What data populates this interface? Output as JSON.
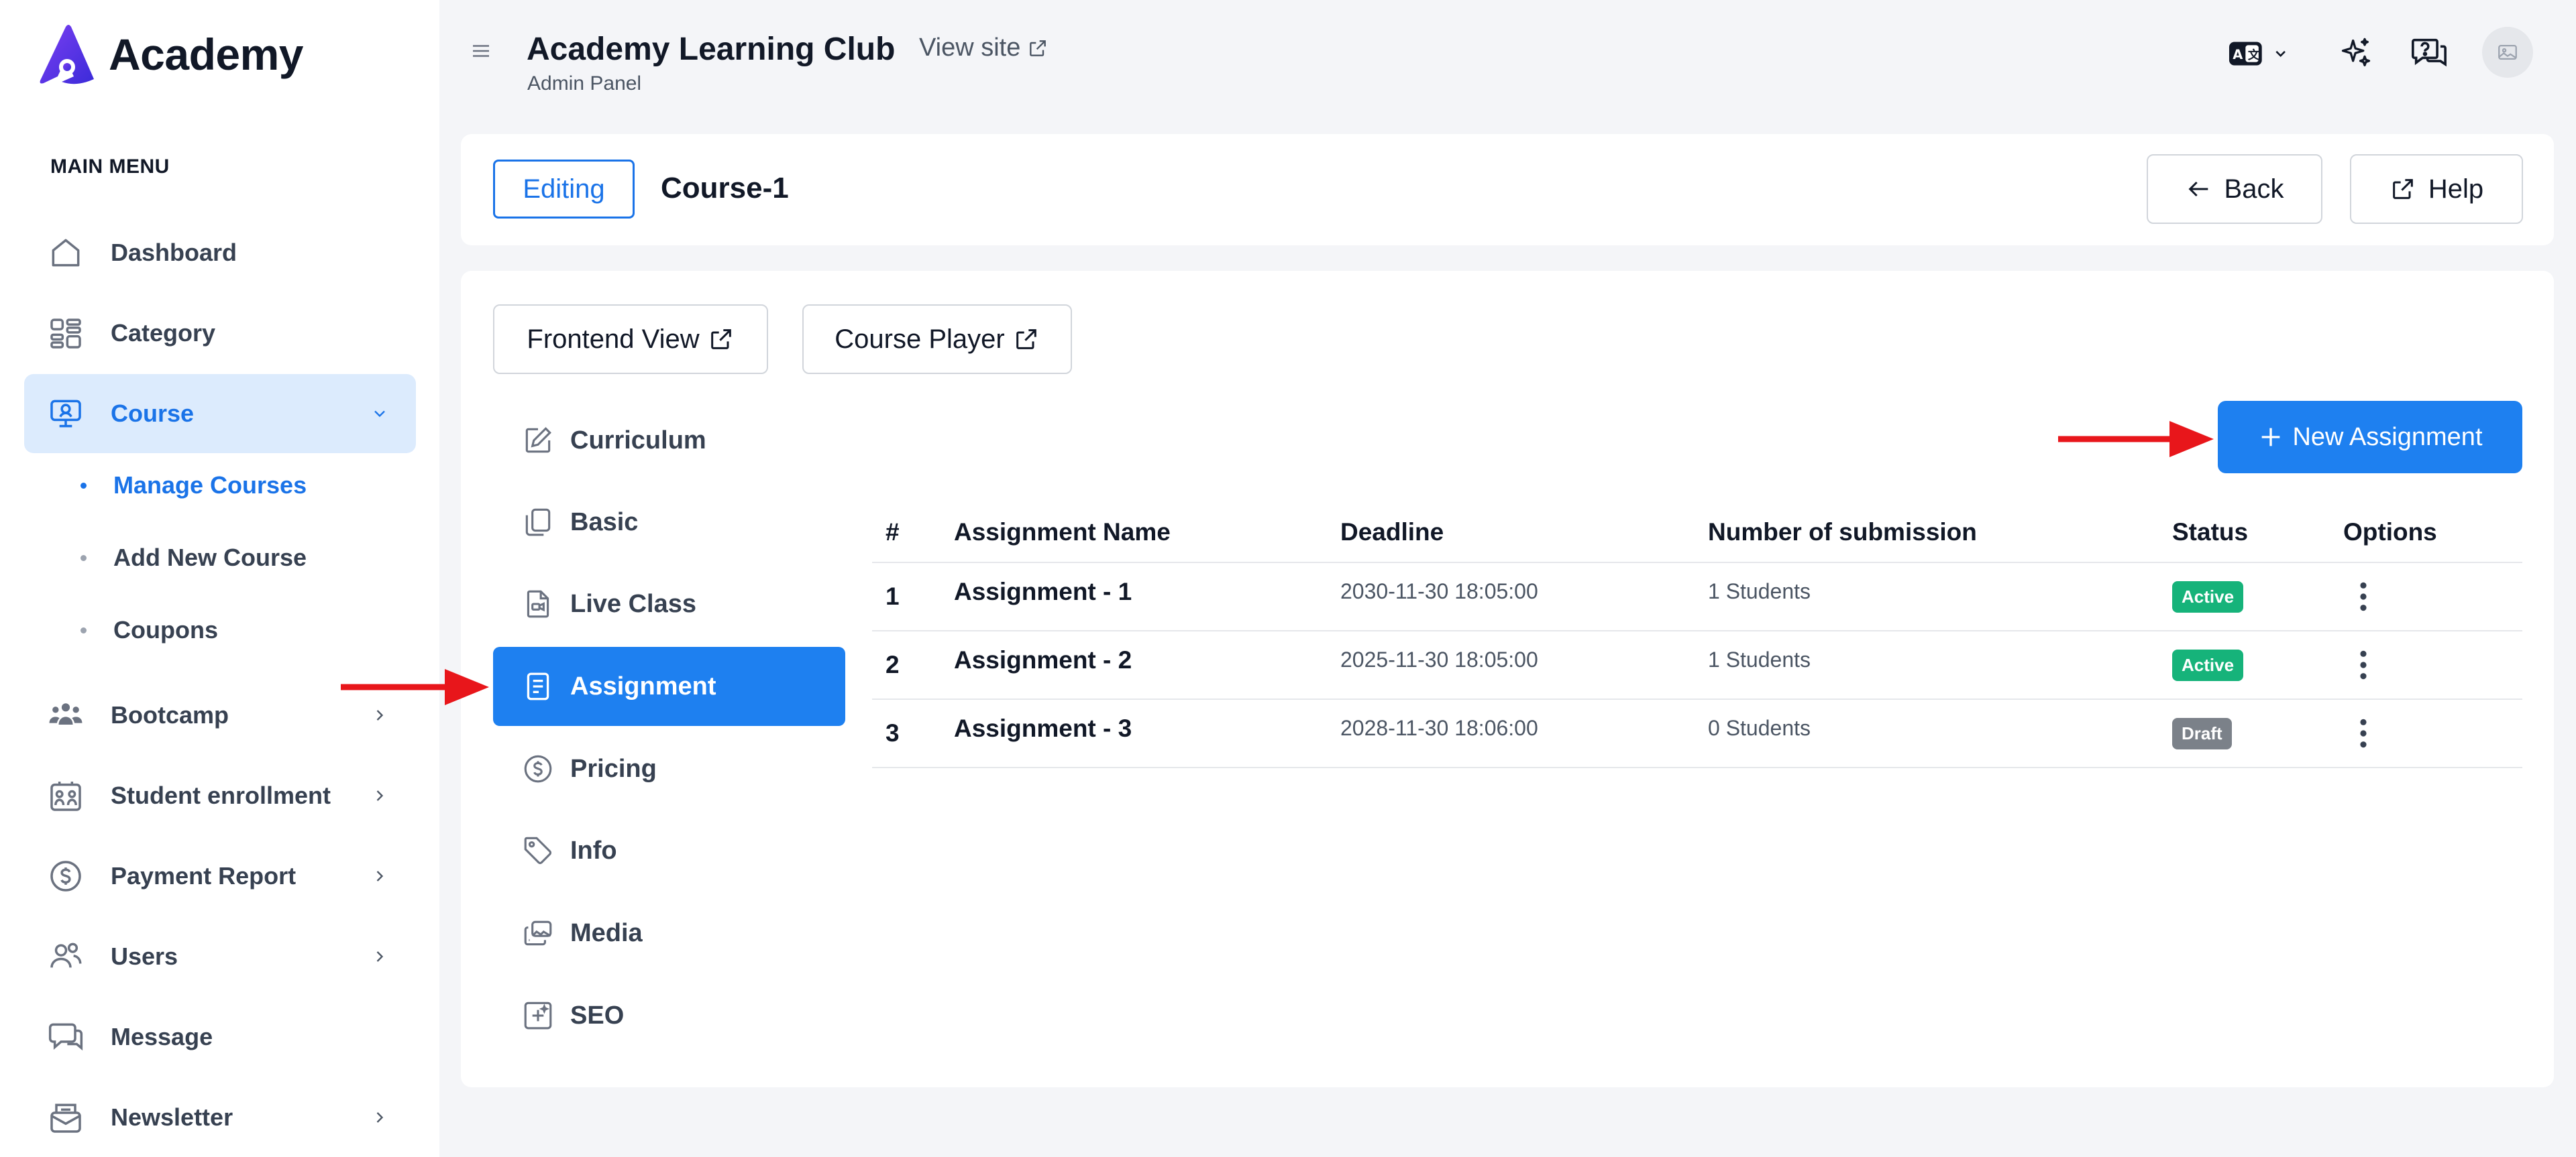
{
  "app": {
    "logo_text": "Academy",
    "site_title": "Academy Learning Club",
    "site_subtitle": "Admin Panel",
    "view_site": "View site"
  },
  "sidebar": {
    "menu_title": "MAIN MENU",
    "items": [
      {
        "label": "Dashboard",
        "icon": "home-icon"
      },
      {
        "label": "Category",
        "icon": "category-icon"
      },
      {
        "label": "Course",
        "icon": "course-icon",
        "active": true
      },
      {
        "label": "Bootcamp",
        "icon": "bootcamp-icon"
      },
      {
        "label": "Student enrollment",
        "icon": "enrollment-icon"
      },
      {
        "label": "Payment Report",
        "icon": "dollar-icon"
      },
      {
        "label": "Users",
        "icon": "users-icon"
      },
      {
        "label": "Message",
        "icon": "message-icon"
      },
      {
        "label": "Newsletter",
        "icon": "newsletter-icon"
      }
    ],
    "course_subitems": [
      {
        "label": "Manage Courses",
        "active": true
      },
      {
        "label": "Add New Course"
      },
      {
        "label": "Coupons"
      }
    ]
  },
  "editor": {
    "badge": "Editing",
    "course_name": "Course-1",
    "back_label": "Back",
    "help_label": "Help",
    "frontend_view": "Frontend View",
    "course_player": "Course Player"
  },
  "course_tabs": [
    {
      "label": "Curriculum",
      "icon": "edit-icon"
    },
    {
      "label": "Basic",
      "icon": "copy-icon"
    },
    {
      "label": "Live Class",
      "icon": "video-file-icon"
    },
    {
      "label": "Assignment",
      "icon": "document-icon",
      "active": true
    },
    {
      "label": "Pricing",
      "icon": "dollar-icon"
    },
    {
      "label": "Info",
      "icon": "tag-icon"
    },
    {
      "label": "Media",
      "icon": "media-icon"
    },
    {
      "label": "SEO",
      "icon": "seo-icon"
    }
  ],
  "new_assignment_label": "New Assignment",
  "table": {
    "headers": [
      "#",
      "Assignment Name",
      "Deadline",
      "Number of submission",
      "Status",
      "Options"
    ],
    "rows": [
      {
        "num": "1",
        "name": "Assignment - 1",
        "deadline": "2030-11-30 18:05:00",
        "submissions": "1 Students",
        "status": "Active"
      },
      {
        "num": "2",
        "name": "Assignment - 2",
        "deadline": "2025-11-30 18:05:00",
        "submissions": "1 Students",
        "status": "Active"
      },
      {
        "num": "3",
        "name": "Assignment - 3",
        "deadline": "2028-11-30 18:06:00",
        "submissions": "0 Students",
        "status": "Draft"
      }
    ]
  },
  "colors": {
    "primary": "#1e80f0",
    "active_badge": "#16b37a",
    "draft_badge": "#7b8189",
    "arrow": "#e8161b"
  }
}
